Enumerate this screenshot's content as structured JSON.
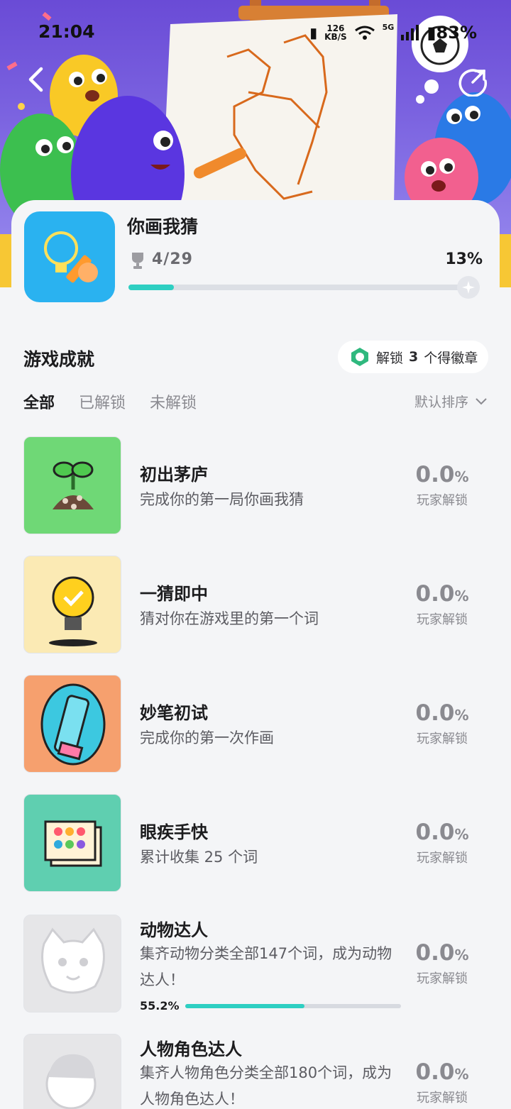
{
  "status_bar": {
    "time": "21:04",
    "net_speed_value": "126",
    "net_speed_unit": "KB/S",
    "network": "5G",
    "battery": "83%"
  },
  "game": {
    "title": "你画我猜",
    "progress_count": "4/29",
    "progress_percent": "13%",
    "progress_fraction": 0.13
  },
  "section": {
    "title": "游戏成就",
    "unlock_prefix": "解锁",
    "unlock_count": "3",
    "unlock_suffix": "个得徽章"
  },
  "tabs": [
    {
      "label": "全部",
      "active": true
    },
    {
      "label": "已解锁",
      "active": false
    },
    {
      "label": "未解锁",
      "active": false
    }
  ],
  "sort_label": "默认排序",
  "achievements": [
    {
      "title": "初出茅庐",
      "desc": "完成你的第一局你画我猜",
      "rate": "0.0",
      "pct": "%",
      "rate_label": "玩家解锁",
      "icon": "sprout-icon",
      "bg": "#6fd876"
    },
    {
      "title": "一猜即中",
      "desc": "猜对你在游戏里的第一个词",
      "rate": "0.0",
      "pct": "%",
      "rate_label": "玩家解锁",
      "icon": "lightbulb-icon",
      "bg": "#fbeab4"
    },
    {
      "title": "妙笔初试",
      "desc": "完成你的第一次作画",
      "rate": "0.0",
      "pct": "%",
      "rate_label": "玩家解锁",
      "icon": "pencil-icon",
      "bg": "#f6a06e"
    },
    {
      "title": "眼疾手快",
      "desc": "累计收集 25 个词",
      "rate": "0.0",
      "pct": "%",
      "rate_label": "玩家解锁",
      "icon": "cards-icon",
      "bg": "#5fcfb0"
    },
    {
      "title": "动物达人",
      "desc": "集齐动物分类全部147个词，成为动物达人！",
      "rate": "0.0",
      "pct": "%",
      "rate_label": "玩家解锁",
      "icon": "cat-icon",
      "bg": "#e6e6e8",
      "progress_label": "55.2%",
      "progress_fraction": 0.552
    },
    {
      "title": "人物角色达人",
      "desc": "集齐人物角色分类全部180个词，成为人物角色达人！",
      "rate": "0.0",
      "pct": "%",
      "rate_label": "玩家解锁",
      "icon": "person-icon",
      "bg": "#e6e6e8"
    }
  ]
}
